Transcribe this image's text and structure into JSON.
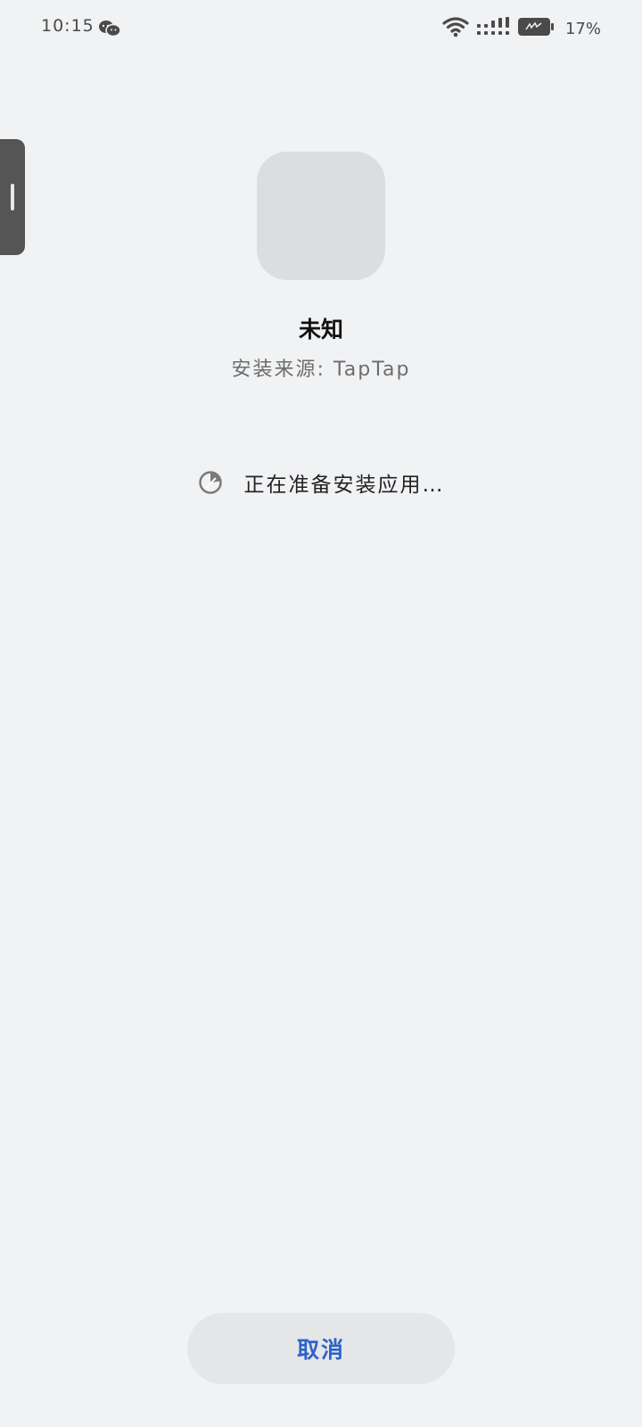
{
  "status_bar": {
    "time": "10:15",
    "battery_percent_text": "17%",
    "battery_level": 0.17,
    "icons": [
      "wechat-icon",
      "wifi-icon",
      "signal-icon",
      "battery-icon"
    ]
  },
  "app": {
    "name": "未知",
    "install_source": "安装来源: TapTap"
  },
  "progress": {
    "message": "正在准备安装应用…",
    "icon": "spinner-icon"
  },
  "actions": {
    "cancel_label": "取消"
  },
  "colors": {
    "background": "#f1f2f4",
    "accent": "#2e62c8",
    "icon_placeholder": "#dcdddf",
    "button_bg": "#e5e6e8"
  }
}
